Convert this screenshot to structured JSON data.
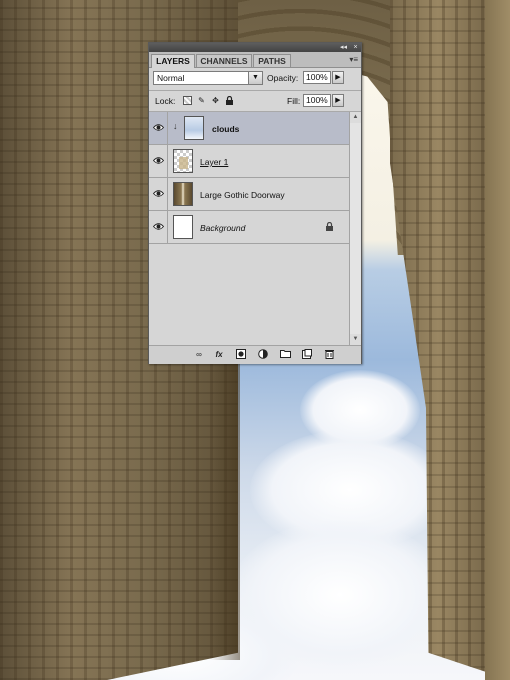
{
  "panel": {
    "tabs": [
      {
        "label": "LAYERS",
        "active": true
      },
      {
        "label": "CHANNELS",
        "active": false
      },
      {
        "label": "PATHS",
        "active": false
      }
    ],
    "titlebar": {
      "collapse_glyph": "◂◂",
      "close_glyph": "×"
    },
    "menu_glyph": "▾≡",
    "blend_mode": "Normal",
    "opacity_label": "Opacity:",
    "opacity_value": "100%",
    "lock_label": "Lock:",
    "fill_label": "Fill:",
    "fill_value": "100%",
    "lock_icons": [
      "lock-transparent-pixels-icon",
      "lock-image-pixels-icon",
      "lock-position-icon",
      "lock-all-icon"
    ],
    "layers": [
      {
        "name": "clouds",
        "selected": true,
        "visible": true,
        "clipped": true,
        "style": "bold"
      },
      {
        "name": "Layer 1",
        "selected": false,
        "visible": true,
        "clipped": false,
        "style": "underline"
      },
      {
        "name": "Large Gothic Doorway",
        "selected": false,
        "visible": true,
        "clipped": false,
        "style": "normal"
      },
      {
        "name": "Background",
        "selected": false,
        "visible": true,
        "clipped": false,
        "style": "italic",
        "locked": true
      }
    ],
    "bottom_icons": [
      "link-layers-icon",
      "layer-style-icon",
      "add-mask-icon",
      "adjustment-layer-icon",
      "new-group-icon",
      "new-layer-icon",
      "delete-layer-icon"
    ]
  },
  "colors": {
    "panel_bg": "#d6d6d6",
    "selected_row": "#b8bcc9",
    "titlebar": "#4d4d4d"
  }
}
